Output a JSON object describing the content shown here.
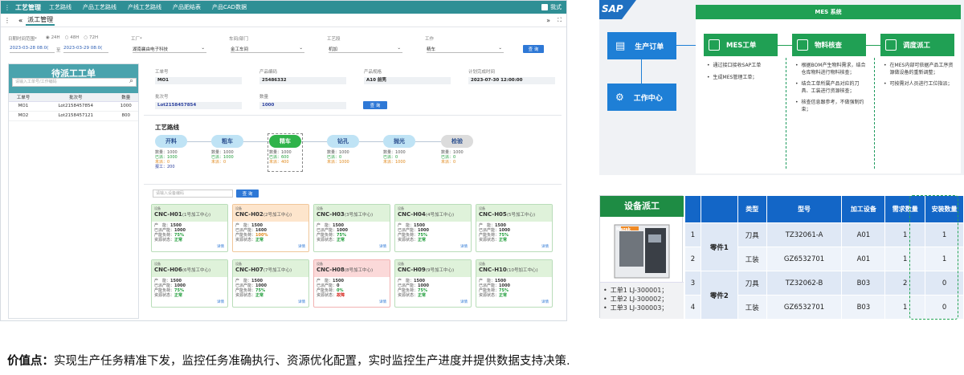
{
  "app": {
    "title": "工艺管理",
    "nav": [
      "工艺路线",
      "产品工艺路线",
      "产线工艺路线",
      "产品肥结表",
      "产品CAD数据"
    ],
    "user": "我式",
    "tab": "派工管理",
    "collapse_label": "«",
    "more_label": "»"
  },
  "filters": {
    "date_label": "日期时间范围",
    "radios": [
      "24H",
      "48H",
      "72H"
    ],
    "date_from": "2023-03-28 08:0(",
    "date_sep": "至",
    "date_to": "2023-03-29 08:0(",
    "factory_label": "工厂",
    "factory_value": "湖南襄由电子科技",
    "workshop_label": "车间/部门",
    "workshop_value": "金工车间",
    "process_label": "工艺段",
    "process_value": "机加",
    "station_label": "工作",
    "station_value": "精车",
    "query_label": "查 询"
  },
  "pending": {
    "title": "待派工工单",
    "search_placeholder": "请输入工单号/工作编码",
    "columns": [
      "工单号",
      "批次号",
      "数量"
    ],
    "rows": [
      [
        "MO1",
        "Lot2158457854",
        "1000"
      ],
      [
        "MO2",
        "Lot2158457121",
        "800"
      ]
    ]
  },
  "order": {
    "labels": [
      "工单号",
      "产品编码",
      "产品规格",
      "计划完成时间",
      "批次号",
      "数量"
    ],
    "wo": "MO1",
    "product_code": "25486332",
    "product_spec": "A10 前壳",
    "plan_time": "2023-07-30  12:00:00",
    "lot": "Lot2158457854",
    "qty": "1000",
    "query_label": "查 询"
  },
  "route": {
    "title": "工艺路线",
    "steps": [
      {
        "name": "开料",
        "color": "#bfe3f5",
        "lines": [
          "数量：1000",
          "已派：1000",
          "未派：0",
          "报工：200"
        ]
      },
      {
        "name": "粗车",
        "color": "#bfe3f5",
        "lines": [
          "数量：1000",
          "已派：1000",
          "未派：0"
        ]
      },
      {
        "name": "精车",
        "color": "#2fb34a",
        "lines": [
          "数量：1000",
          "已派：600",
          "未派：400"
        ]
      },
      {
        "name": "钻孔",
        "color": "#bfe3f5",
        "lines": [
          "数量：1000",
          "已派：0",
          "未派：1000"
        ]
      },
      {
        "name": "抛光",
        "color": "#bfe3f5",
        "lines": [
          "数量：1000",
          "已派：0",
          "未派：1000"
        ]
      },
      {
        "name": "检验",
        "color": "#dcdcdc",
        "lines": [
          "数量：1000",
          "已派：0",
          "未派：0"
        ]
      }
    ]
  },
  "devices": {
    "search_placeholder": "请输入设备编码",
    "query_label": "查 询",
    "tag": "设备",
    "detail": "详情",
    "field_labels": [
      "产　能：",
      "已派产能：",
      "产能负荷：",
      "资源状态："
    ],
    "cards": [
      {
        "code": "CNC-H01",
        "sub": "(1号加工中心)",
        "style": "green",
        "vals": [
          "1500",
          "1000",
          "75%",
          "正常"
        ]
      },
      {
        "code": "CNC-H02",
        "sub": "(2号加工中心)",
        "style": "orange",
        "vals": [
          "1500",
          "1600",
          "100%",
          "正常"
        ]
      },
      {
        "code": "CNC-H03",
        "sub": "(3号加工中心)",
        "style": "green",
        "vals": [
          "1500",
          "1000",
          "75%",
          "正常"
        ]
      },
      {
        "code": "CNC-H04",
        "sub": "(4号加工中心)",
        "style": "green",
        "vals": [
          "1500",
          "1000",
          "75%",
          "正常"
        ]
      },
      {
        "code": "CNC-H05",
        "sub": "(5号加工中心)",
        "style": "green",
        "vals": [
          "1500",
          "1000",
          "75%",
          "正常"
        ]
      },
      {
        "code": "CNC-H06",
        "sub": "(6号加工中心)",
        "style": "green",
        "vals": [
          "1500",
          "1000",
          "75%",
          "正常"
        ]
      },
      {
        "code": "CNC-H07",
        "sub": "(7号加工中心)",
        "style": "green",
        "vals": [
          "1500",
          "1000",
          "75%",
          "正常"
        ]
      },
      {
        "code": "CNC-H08",
        "sub": "(8号加工中心)",
        "style": "red",
        "vals": [
          "1500",
          "0",
          "0%",
          "故障"
        ]
      },
      {
        "code": "CNC-H09",
        "sub": "(9号加工中心)",
        "style": "green",
        "vals": [
          "1500",
          "1000",
          "75%",
          "正常"
        ]
      },
      {
        "code": "CNC-H10",
        "sub": "(10号加工中心)",
        "style": "green",
        "vals": [
          "1500",
          "1000",
          "75%",
          "正常"
        ]
      }
    ]
  },
  "flow": {
    "sap": "SAP",
    "mes_system": "MES 系统",
    "left_nodes": [
      "生产订单",
      "工作中心"
    ],
    "columns": [
      {
        "title": "MES工单",
        "bullets": [
          "通过接口接收SAP工单",
          "生成MES管理工单；"
        ]
      },
      {
        "title": "物料核查",
        "bullets": [
          "根据BOM产生物料需求，结合仓库物料进行物料核查；",
          "结合工单所属产品对应的刀具、工装进行资源核查；",
          "核查信息跟参考，不做强制约束；"
        ]
      },
      {
        "title": "调度派工",
        "bullets": [
          "在MES内部可依据产品工序资源做设备的重新调整；",
          "可按需对人员进行工位指派；"
        ]
      }
    ]
  },
  "dispatch": {
    "title": "设备派工",
    "machine_brand": "Mazak",
    "list": [
      "工单1 LJ-300001；",
      "工单2 LJ-300002；",
      "工单3 LJ-300003；"
    ],
    "columns": [
      "",
      "",
      "类型",
      "型号",
      "加工设备",
      "需求数量",
      "安装数量"
    ],
    "rows": [
      {
        "idx": "1",
        "part": "零件1",
        "type": "刀具",
        "model": "TZ32061-A",
        "dev": "A01",
        "need": "1",
        "inst": "1"
      },
      {
        "idx": "2",
        "part": "",
        "type": "工装",
        "model": "GZ6532701",
        "dev": "A01",
        "need": "1",
        "inst": "1"
      },
      {
        "idx": "3",
        "part": "零件2",
        "type": "刀具",
        "model": "TZ32062-B",
        "dev": "B03",
        "need": "2",
        "inst": "0"
      },
      {
        "idx": "4",
        "part": "",
        "type": "工装",
        "model": "GZ6532701",
        "dev": "B03",
        "need": "1",
        "inst": "0"
      }
    ]
  },
  "footer": {
    "label": "价值点：",
    "text": "实现生产任务精准下发，监控任务准确执行、资源优化配置，实时监控生产进度并提供数据支持决策."
  }
}
